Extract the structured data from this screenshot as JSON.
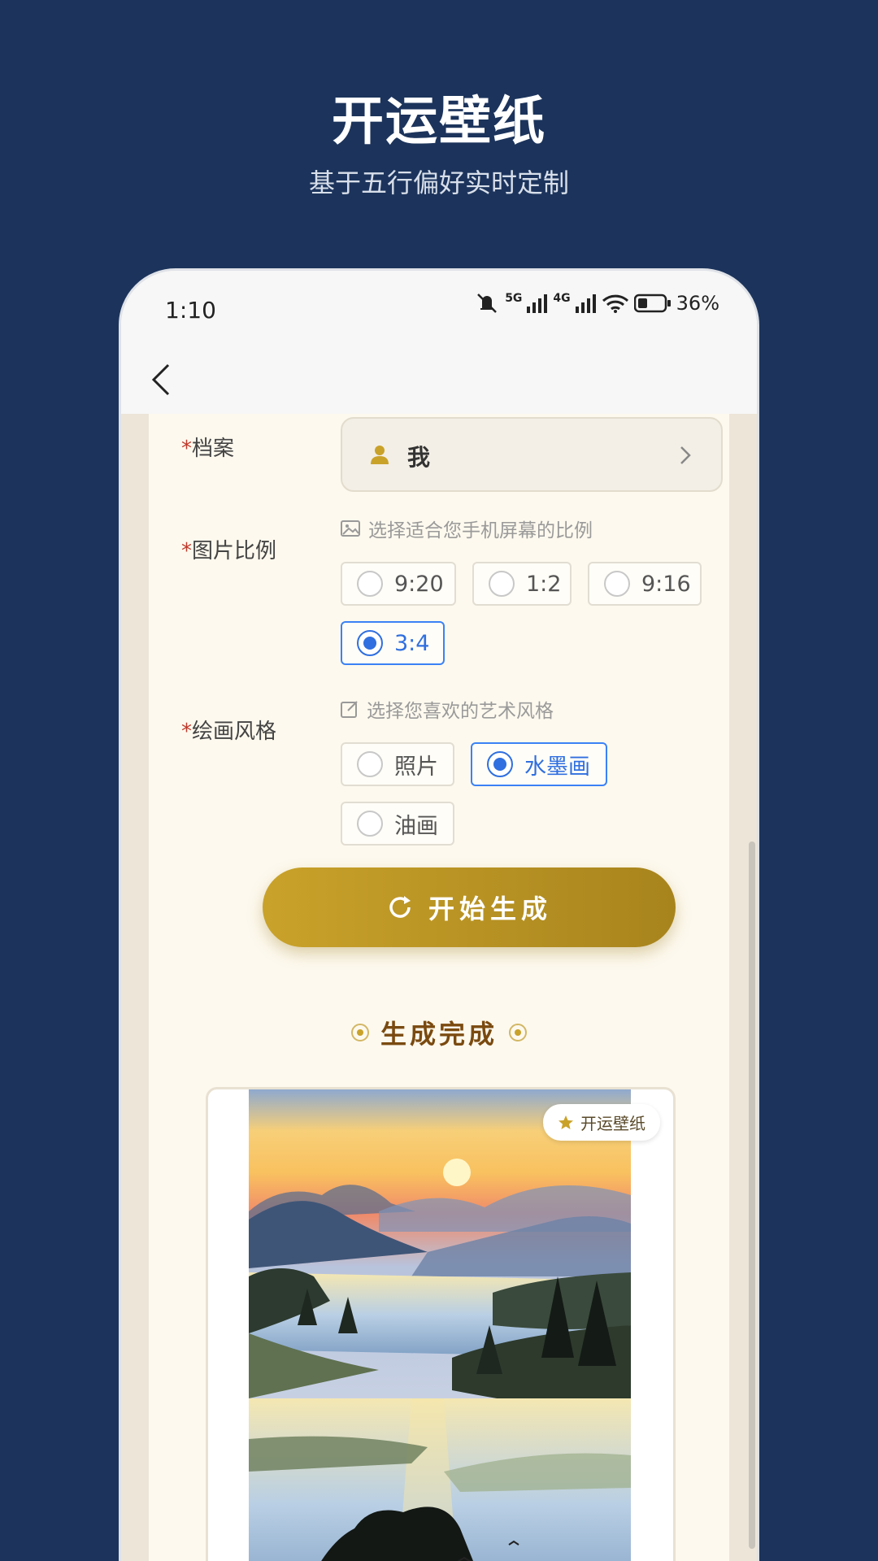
{
  "promo": {
    "title": "开运壁纸",
    "subtitle": "基于五行偏好实时定制"
  },
  "status": {
    "time": "1:10",
    "network1": "5G",
    "network2": "4G",
    "battery": "36%"
  },
  "form": {
    "profile": {
      "label": "档案",
      "value": "我"
    },
    "ratio": {
      "label": "图片比例",
      "hint": "选择适合您手机屏幕的比例",
      "options": [
        "9:20",
        "1:2",
        "9:16",
        "3:4"
      ],
      "selected": "3:4"
    },
    "style": {
      "label": "绘画风格",
      "hint": "选择您喜欢的艺术风格",
      "options": [
        "照片",
        "水墨画",
        "油画"
      ],
      "selected": "水墨画"
    },
    "required_mark": "*",
    "generate_label": "开始生成"
  },
  "result": {
    "title": "生成完成",
    "badge": "开运壁纸"
  },
  "colors": {
    "background": "#1c345c",
    "gold": "#c9a22a",
    "accent_blue": "#2f6fe0"
  }
}
